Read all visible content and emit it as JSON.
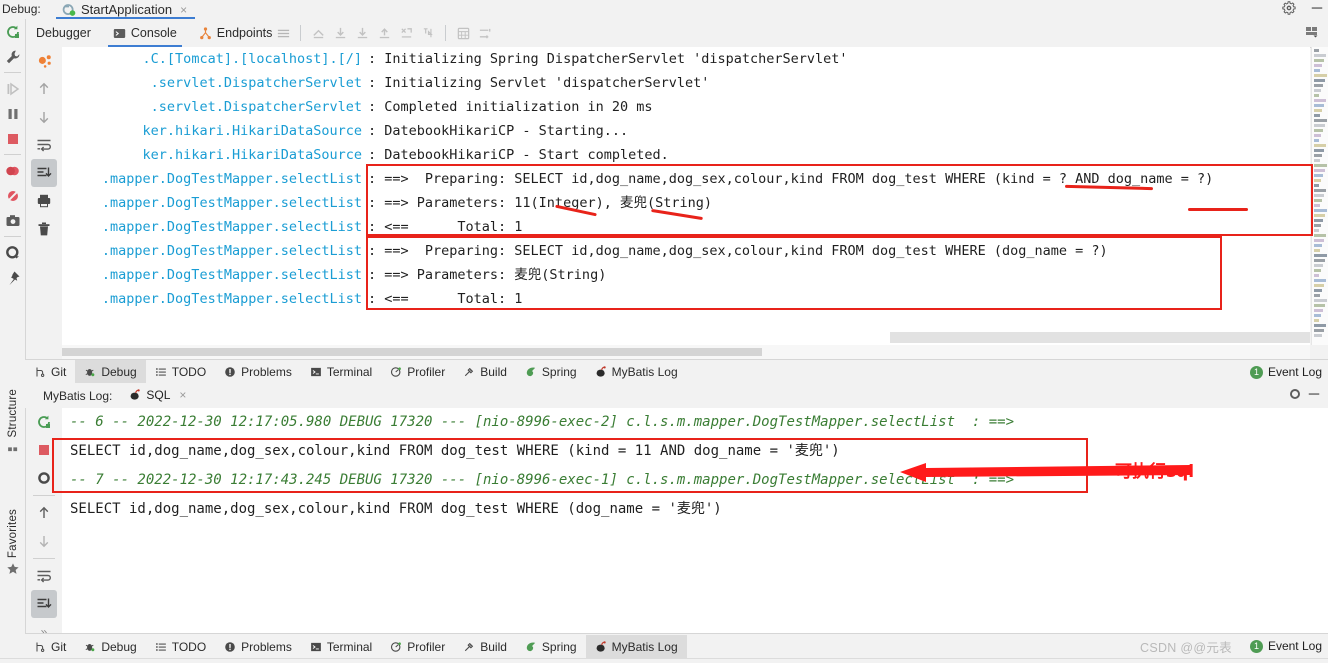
{
  "window": {
    "debug_label": "Debug:",
    "config_tab": "StartApplication",
    "close_glyph": "×"
  },
  "debug_toolbar": {
    "tabs": [
      {
        "label": "Debugger",
        "icon": "debugger-icon",
        "selected": false
      },
      {
        "label": "Console",
        "icon": "console-icon",
        "selected": true
      },
      {
        "label": "Endpoints",
        "icon": "endpoints-icon",
        "selected": false
      }
    ],
    "actions": [
      "menu-icon",
      "step-out-icon",
      "step-over-icon",
      "step-into-icon",
      "force-step-into-icon",
      "run-to-cursor-icon",
      "evaluate-icon",
      "frames-icon",
      "settings-icon"
    ]
  },
  "left_strip": {
    "top_icons": [
      "rerun-icon",
      "wrench-icon",
      "resume-icon",
      "pause-icon",
      "stop-icon",
      "breakpoints-icon",
      "mute-breakpoints-icon",
      "snapshot-icon",
      "settings-gear-icon",
      "pin-icon"
    ],
    "bottom_labels": [
      {
        "label": "Structure",
        "icon": "structure-icon"
      },
      {
        "label": "Favorites",
        "icon": "star-icon"
      }
    ]
  },
  "session_toolbar": {
    "icons": [
      "soft-wrap-icon",
      "up-arrow-icon",
      "down-arrow-icon",
      "wrap-text-icon",
      "scroll-end-icon",
      "print-icon",
      "trash-icon"
    ]
  },
  "console": {
    "lines": [
      {
        "category": ".C.[Tomcat].[localhost].[/]",
        "message": ": Initializing Spring DispatcherServlet 'dispatcherServlet'"
      },
      {
        "category": ".servlet.DispatcherServlet",
        "message": ": Initializing Servlet 'dispatcherServlet'"
      },
      {
        "category": ".servlet.DispatcherServlet",
        "message": ": Completed initialization in 20 ms"
      },
      {
        "category": "ker.hikari.HikariDataSource",
        "message": ": DatebookHikariCP - Starting..."
      },
      {
        "category": "ker.hikari.HikariDataSource",
        "message": ": DatebookHikariCP - Start completed."
      },
      {
        "category": ".mapper.DogTestMapper.selectList",
        "message": ": ==>  Preparing: SELECT id,dog_name,dog_sex,colour,kind FROM dog_test WHERE (kind = ? AND dog_name = ?)"
      },
      {
        "category": ".mapper.DogTestMapper.selectList",
        "message": ": ==> Parameters: 11(Integer), 麦兜(String)"
      },
      {
        "category": ".mapper.DogTestMapper.selectList",
        "message": ": <==      Total: 1"
      },
      {
        "category": ".mapper.DogTestMapper.selectList",
        "message": ": ==>  Preparing: SELECT id,dog_name,dog_sex,colour,kind FROM dog_test WHERE (dog_name = ?)"
      },
      {
        "category": ".mapper.DogTestMapper.selectList",
        "message": ": ==> Parameters: 麦兜(String)"
      },
      {
        "category": ".mapper.DogTestMapper.selectList",
        "message": ": <==      Total: 1"
      }
    ],
    "annotation_color": "#e8231a"
  },
  "tool_window_bar": {
    "tabs": [
      {
        "label": "Git",
        "icon": "git-icon",
        "selected": false
      },
      {
        "label": "Debug",
        "icon": "debug-icon",
        "selected": true
      },
      {
        "label": "TODO",
        "icon": "todo-icon",
        "selected": false
      },
      {
        "label": "Problems",
        "icon": "problems-icon",
        "selected": false
      },
      {
        "label": "Terminal",
        "icon": "terminal-icon",
        "selected": false
      },
      {
        "label": "Profiler",
        "icon": "profiler-icon",
        "selected": false
      },
      {
        "label": "Build",
        "icon": "build-icon",
        "selected": false
      },
      {
        "label": "Spring",
        "icon": "spring-icon",
        "selected": false
      },
      {
        "label": "MyBatis Log",
        "icon": "mybatis-icon",
        "selected": false
      }
    ],
    "event_log": {
      "label": "Event Log",
      "count": "1"
    }
  },
  "mybatis_panel": {
    "title": "MyBatis Log:",
    "tab": "SQL",
    "close_glyph": "×",
    "toolbar_icons": [
      "rerun-icon",
      "stop-icon",
      "settings-gear-icon",
      "up-arrow-icon",
      "down-arrow-icon",
      "wrap-text-icon",
      "scroll-end-icon",
      "expand-more-icon"
    ],
    "entries": [
      {
        "comment": "-- 6 -- 2022-12-30 12:17:05.980 DEBUG 17320 --- [nio-8996-exec-2] c.l.s.m.mapper.DogTestMapper.selectList  : ==>",
        "sql": "SELECT id,dog_name,dog_sex,colour,kind FROM dog_test WHERE (kind = 11 AND dog_name = '麦兜')"
      },
      {
        "comment": "-- 7 -- 2022-12-30 12:17:43.245 DEBUG 17320 --- [nio-8996-exec-1] c.l.s.m.mapper.DogTestMapper.selectList  : ==>",
        "sql": "SELECT id,dog_name,dog_sex,colour,kind FROM dog_test WHERE (dog_name = '麦兜')"
      }
    ]
  },
  "bottom_bar": {
    "tabs": [
      {
        "label": "Git",
        "icon": "git-icon",
        "selected": false
      },
      {
        "label": "Debug",
        "icon": "debug-icon",
        "selected": false
      },
      {
        "label": "TODO",
        "icon": "todo-icon",
        "selected": false
      },
      {
        "label": "Problems",
        "icon": "problems-icon",
        "selected": false
      },
      {
        "label": "Terminal",
        "icon": "terminal-icon",
        "selected": false
      },
      {
        "label": "Profiler",
        "icon": "profiler-icon",
        "selected": false
      },
      {
        "label": "Build",
        "icon": "build-icon",
        "selected": false
      },
      {
        "label": "Spring",
        "icon": "spring-icon",
        "selected": false
      },
      {
        "label": "MyBatis Log",
        "icon": "mybatis-icon",
        "selected": true
      }
    ],
    "event_log": {
      "label": "Event Log",
      "count": "1"
    },
    "watermark": "CSDN @@元表"
  },
  "annotations": {
    "executable_sql_note": "可执行sql",
    "arrow_color": "#ff1a1a"
  }
}
